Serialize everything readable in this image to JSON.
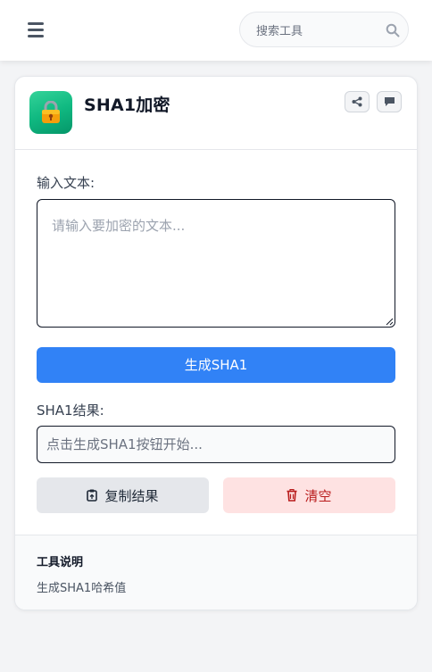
{
  "header": {
    "search_placeholder": "搜索工具"
  },
  "tool": {
    "title": "SHA1加密",
    "icon": "lock-icon",
    "input_label": "输入文本:",
    "input_placeholder": "请输入要加密的文本...",
    "input_value": "",
    "generate_label": "生成SHA1",
    "result_label": "SHA1结果:",
    "result_placeholder": "点击生成SHA1按钮开始...",
    "result_value": "",
    "copy_label": "复制结果",
    "clear_label": "清空"
  },
  "footer": {
    "title": "工具说明",
    "description": "生成SHA1哈希值"
  },
  "colors": {
    "primary": "#3182f6",
    "icon_gradient": "#10b981",
    "danger_bg": "#fee2e2",
    "danger_text": "#b91c1c"
  }
}
